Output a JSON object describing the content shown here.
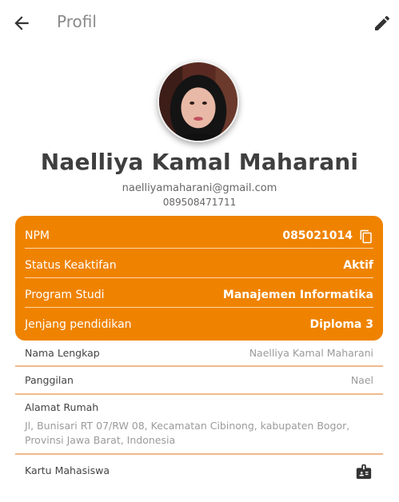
{
  "appbar": {
    "title": "Profil",
    "back_icon": "arrow-back-icon",
    "edit_icon": "edit-pencil-icon"
  },
  "profile": {
    "name": "Naelliya Kamal Maharani",
    "email": "naelliyamaharani@gmail.com",
    "phone": "089508471711"
  },
  "academic": {
    "accent": "#ef8300",
    "rows": [
      {
        "label": "NPM",
        "value": "085021014"
      },
      {
        "label": "Status Keaktifan",
        "value": "Aktif"
      },
      {
        "label": "Program Studi",
        "value": "Manajemen Informatika"
      },
      {
        "label": "Jenjang pendidikan",
        "value": "Diploma 3"
      }
    ]
  },
  "details": {
    "full_name_label": "Nama Lengkap",
    "full_name_value": "Naelliya Kamal Maharani",
    "nickname_label": "Panggilan",
    "nickname_value": "Nael",
    "address_label": "Alamat Rumah",
    "address_value": "Jl, Bunisari RT 07/RW 08, Kecamatan Cibinong, kabupaten Bogor, Provinsi Jawa Barat, Indonesia",
    "student_card_label": "Kartu Mahasiswa"
  }
}
